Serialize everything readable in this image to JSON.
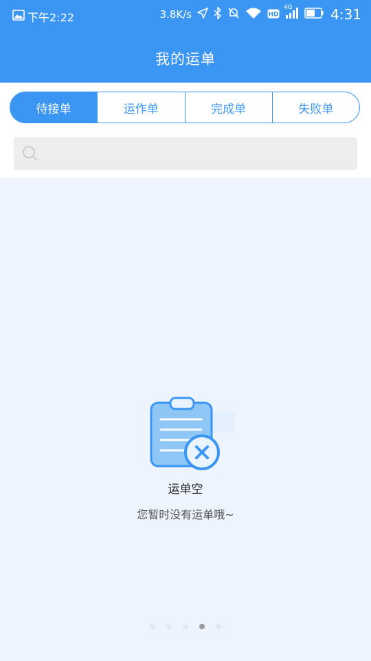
{
  "status_bar": {
    "time_left": "下午2:22",
    "net_speed": "3.8K/s",
    "network_type": "4G",
    "clock": "4:31",
    "icons": [
      "image-icon",
      "location-icon",
      "bluetooth-icon",
      "mute-icon",
      "wifi-icon",
      "hd-icon",
      "signal-icon",
      "battery-icon"
    ]
  },
  "header": {
    "title": "我的运单"
  },
  "tabs": [
    {
      "label": "待接单",
      "active": true
    },
    {
      "label": "运作单",
      "active": false
    },
    {
      "label": "完成单",
      "active": false
    },
    {
      "label": "失败单",
      "active": false
    }
  ],
  "search": {
    "placeholder": ""
  },
  "empty_state": {
    "title": "运单空",
    "description": "您暂时没有运单哦~",
    "icon": "clipboard-error-icon"
  },
  "pager": {
    "count": 5,
    "active_index": 3
  },
  "colors": {
    "primary": "#3b96f3",
    "background": "#eef4fd",
    "search_bg": "#ededed"
  }
}
